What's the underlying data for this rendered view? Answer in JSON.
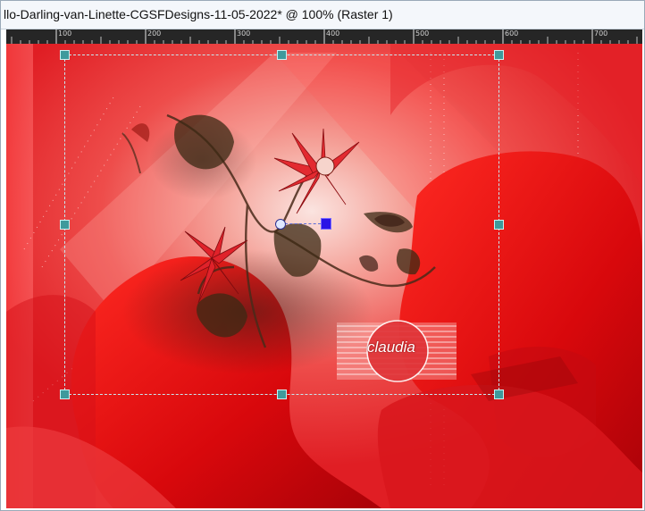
{
  "window": {
    "title": "llo-Darling-van-Linette-CGSFDesigns-11-05-2022* @ 100% (Raster 1)"
  },
  "ruler": {
    "labels": [
      "100",
      "200",
      "300",
      "400",
      "500",
      "600",
      "700"
    ]
  },
  "canvas": {
    "watermark_text": "claudia",
    "colors": {
      "background": "#e41f24",
      "light": "#f77a74",
      "dark": "#a50c10",
      "handle": "#3e9a9c",
      "rotate_handle": "#2a13e6"
    }
  }
}
